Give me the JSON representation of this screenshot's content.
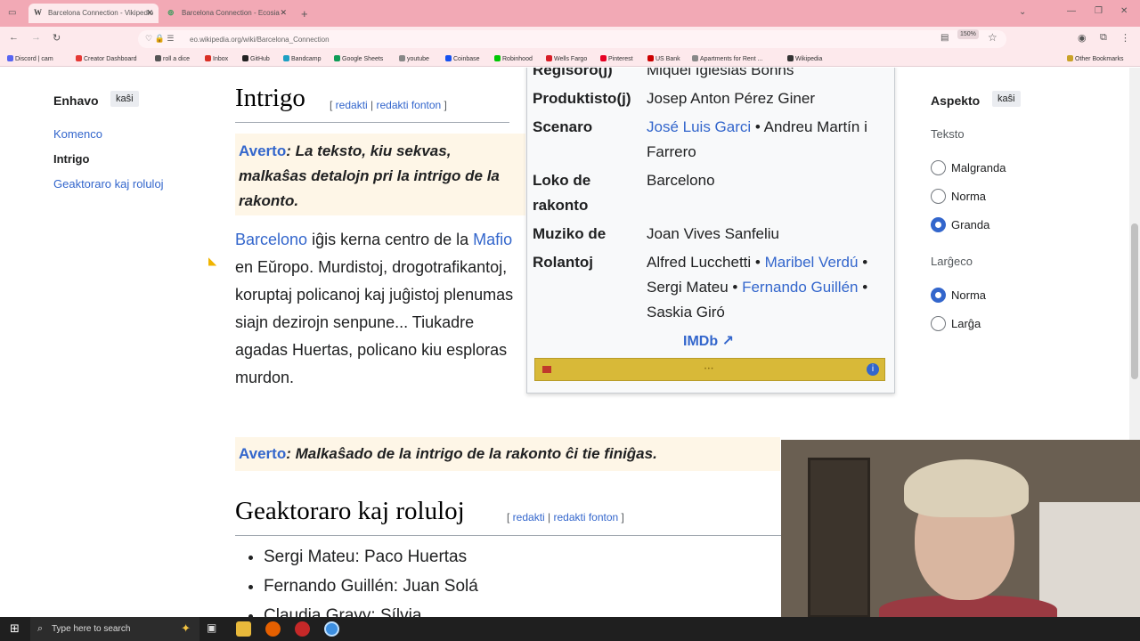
{
  "browser": {
    "tabs": [
      {
        "title": "Barcelona Connection - Vikipedio",
        "favicon": "W",
        "active": true
      },
      {
        "title": "Barcelona Connection - Ecosia",
        "favicon": "ecosia-icon",
        "active": false
      }
    ],
    "url": "eo.wikipedia.org/wiki/Barcelona_Connection",
    "zoom": "150%",
    "bookmarks": [
      {
        "label": "Discord | cam",
        "color": "#5865f2"
      },
      {
        "label": "Creator Dashboard",
        "color": "#e53935"
      },
      {
        "label": "roll a dice",
        "color": "#555555"
      },
      {
        "label": "Inbox",
        "color": "#d93025"
      },
      {
        "label": "GitHub",
        "color": "#222222"
      },
      {
        "label": "Bandcamp",
        "color": "#1da0c3"
      },
      {
        "label": "Google Sheets",
        "color": "#0f9d58"
      },
      {
        "label": "youtube",
        "color": "#888888"
      },
      {
        "label": "Coinbase",
        "color": "#1652f0"
      },
      {
        "label": "Robinhood",
        "color": "#00c805"
      },
      {
        "label": "Wells Fargo",
        "color": "#d71e28"
      },
      {
        "label": "Pinterest",
        "color": "#e60023"
      },
      {
        "label": "US Bank",
        "color": "#cc0000"
      },
      {
        "label": "Apartments for Rent ...",
        "color": "#888888"
      },
      {
        "label": "Wikipedia",
        "color": "#333333"
      }
    ],
    "other_bookmarks": "Other Bookmarks"
  },
  "toc": {
    "title": "Enhavo",
    "hide": "kaŝi",
    "items": [
      "Komenco",
      "Intrigo",
      "Geaktoraro kaj roluloj"
    ]
  },
  "article": {
    "section1": {
      "title": "Intrigo",
      "edit": "redakti",
      "edit_source": "redakti fonton",
      "warning_label": "Averto",
      "warning_text": "La teksto, kiu sekvas, malkaŝas detalojn pri la intrigo de la rakonto.",
      "para_link1": "Barcelono",
      "para_text1": " iĝis kerna centro de la ",
      "para_link2": "Mafio",
      "para_text2": " en Eŭropo. Murdistoj, drogotrafikantoj, koruptaj policanoj kaj juĝistoj plenumas siajn dezirojn senpune... Tiukadre agadas Huertas, policano kiu esploras murdon.",
      "end_warning": "Malkaŝado de la intrigo de la rakonto ĉi tie finiĝas."
    },
    "section2": {
      "title": "Geaktoraro kaj roluloj",
      "edit": "redakti",
      "edit_source": "redakti fonton",
      "cast": [
        "Sergi Mateu: Paco Huertas",
        "Fernando Guillén: Juan Solá",
        "Claudia Gravy: Sílvia"
      ]
    }
  },
  "infobox": {
    "rows": [
      {
        "label": "Reĝisoro(j)",
        "value": "Miquel Iglesias Bonns"
      },
      {
        "label": "Produktisto(j)",
        "value": "Josep Anton Pérez Giner"
      },
      {
        "label": "Scenaro",
        "link": "José Luis Garci",
        "value": " • Andreu Martín i Farrero"
      },
      {
        "label": "Loko de rakonto",
        "link": "Barcelono"
      },
      {
        "label": "Muziko de",
        "value": "Joan Vives Sanfeliu"
      },
      {
        "label": "Rolantoj",
        "v1": "Alfred Lucchetti • ",
        "l1": "Maribel Verdú",
        "v2": " • Sergi Mateu • ",
        "l2": "Fernando Guillén",
        "v3": " • Saskia Giró"
      }
    ],
    "imdb": "IMDb"
  },
  "appearance": {
    "title": "Aspekto",
    "hide": "kaŝi",
    "text_label": "Teksto",
    "text_options": [
      {
        "label": "Malgranda",
        "checked": false
      },
      {
        "label": "Norma",
        "checked": false
      },
      {
        "label": "Granda",
        "checked": true
      }
    ],
    "width_label": "Larĝeco",
    "width_options": [
      {
        "label": "Norma",
        "checked": true
      },
      {
        "label": "Larĝa",
        "checked": false
      }
    ]
  },
  "taskbar": {
    "search_placeholder": "Type here to search"
  }
}
